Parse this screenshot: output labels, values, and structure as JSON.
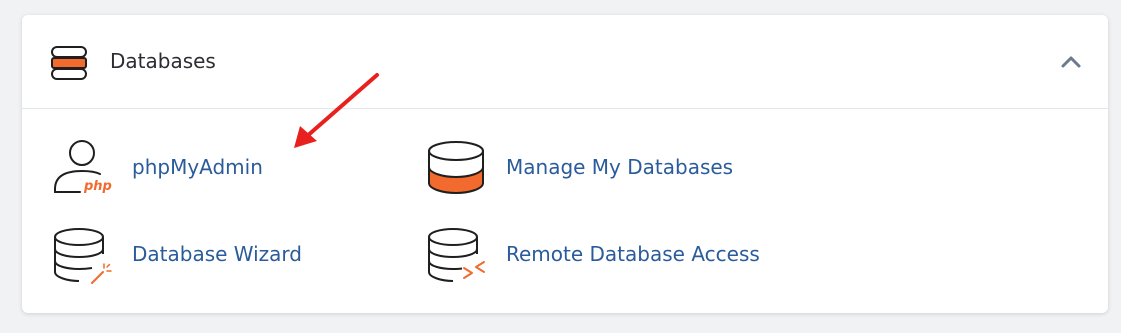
{
  "section": {
    "title": "Databases",
    "collapse_icon": "chevron-up-icon",
    "header_icon": "database-icon"
  },
  "items": [
    {
      "label": "phpMyAdmin",
      "icon": "phpmyadmin-icon",
      "icon_badge": "php"
    },
    {
      "label": "Manage My Databases",
      "icon": "database-icon"
    },
    {
      "label": "Database Wizard",
      "icon": "database-wizard-icon"
    },
    {
      "label": "Remote Database Access",
      "icon": "remote-database-icon"
    }
  ],
  "colors": {
    "accent": "#f26a2e",
    "link": "#2a5b9a",
    "annotation_arrow": "#e8211f",
    "icon_stroke": "#1f1f1f"
  }
}
